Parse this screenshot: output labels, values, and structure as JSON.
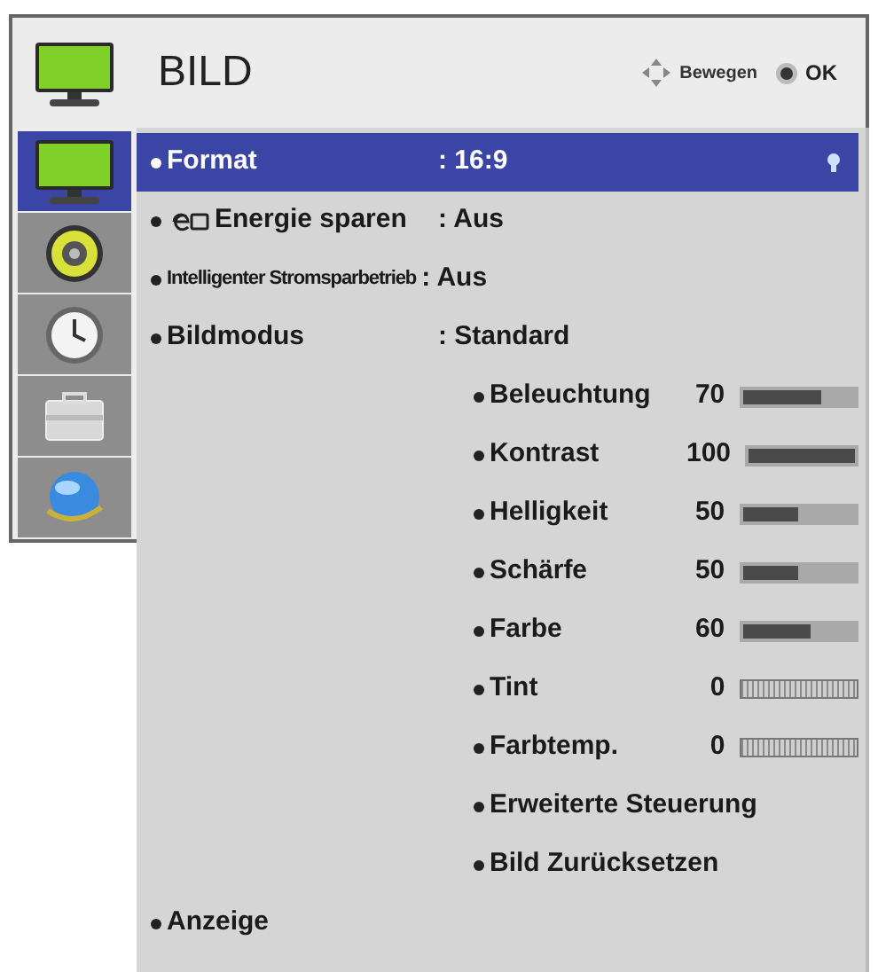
{
  "menu": {
    "title": "BILD",
    "hints": [
      {
        "kind": "move",
        "label": "Bewegen"
      },
      {
        "kind": "ok",
        "label": "OK"
      }
    ]
  },
  "sidebar": {
    "items": [
      {
        "kind": "tv",
        "selected": true
      },
      {
        "kind": "speaker",
        "selected": false
      },
      {
        "kind": "clock",
        "selected": false
      },
      {
        "kind": "toolbox",
        "selected": false
      },
      {
        "kind": "globe",
        "selected": false
      }
    ]
  },
  "settings": [
    {
      "kind": "option",
      "label": "Format",
      "value": ": 16:9",
      "selected": true
    },
    {
      "kind": "eco_option",
      "label": "Energie sparen",
      "value": ": Aus",
      "selected": false
    },
    {
      "kind": "compact_option",
      "label": "Intelligenter Stromsparbetrieb",
      "value": ": Aus",
      "selected": false
    },
    {
      "kind": "option",
      "label": "Bildmodus",
      "value": ": Standard",
      "selected": false,
      "children": [
        {
          "kind": "level",
          "label": "Beleuchtung",
          "value": "70",
          "level": 0.7,
          "selected": false
        },
        {
          "kind": "level",
          "label": "Kontrast",
          "value": "100",
          "level": 1,
          "selected": false
        },
        {
          "kind": "level",
          "label": "Helligkeit",
          "value": "50",
          "level": 0.5,
          "selected": false
        },
        {
          "kind": "level",
          "label": "Schärfe",
          "value": "50",
          "level": 0.5,
          "selected": false
        },
        {
          "kind": "level",
          "label": "Farbe",
          "value": "60",
          "level": 0.6,
          "selected": false
        },
        {
          "kind": "balance",
          "label": "Tint",
          "value": "0",
          "selected": false
        },
        {
          "kind": "balance",
          "label": "Farbtemp.",
          "value": "0",
          "selected": false
        },
        {
          "kind": "action",
          "label": "Erweiterte Steuerung",
          "selected": false
        },
        {
          "kind": "action",
          "label": "Bild Zurücksetzen",
          "selected": false
        }
      ]
    },
    {
      "kind": "option",
      "label": "Anzeige",
      "selected": false
    }
  ]
}
